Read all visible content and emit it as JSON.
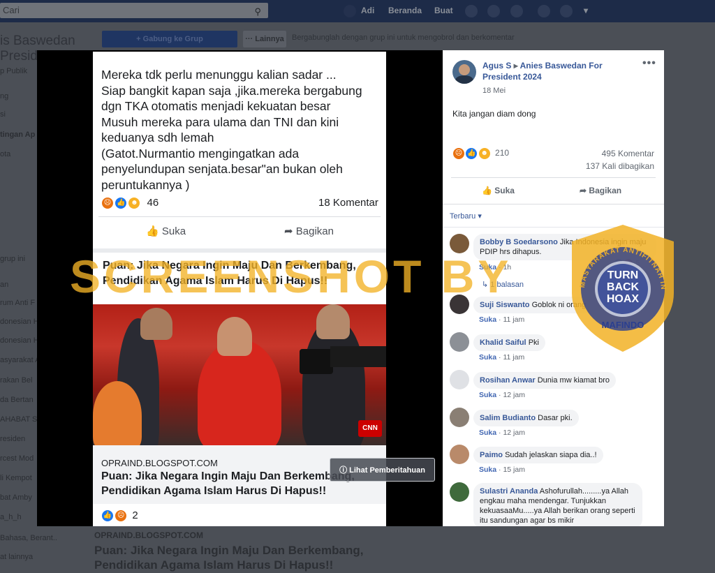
{
  "topbar": {
    "search_placeholder": "Cari",
    "user_name": "Adi",
    "home_label": "Beranda",
    "create_label": "Buat"
  },
  "sidebar": {
    "group_title_line1": "is Baswedan",
    "group_title_line2": "Preside",
    "group_privacy": "p Publik",
    "items": [
      "ng",
      "si",
      "tingan Ap",
      "ota",
      "",
      "grup ini",
      "an",
      "rum Anti F",
      "donesian H",
      "donesian H",
      "asyarakat A",
      "rakan Bel",
      "da Bertan",
      "AHABAT S",
      "residen",
      "rcest Mod",
      "li Kempot",
      "bat Amby",
      "a_h_h",
      "Bahasa, Berant..",
      "at lainnya"
    ]
  },
  "group_bar": {
    "join_label": "+ Gabung ke Grup",
    "more_label": "··· Lainnya",
    "note": "Bergabunglah dengan grup ini untuk mengobrol dan berkomentar"
  },
  "background_post": {
    "source": "OPRAIND.BLOGSPOT.COM",
    "title_line1": "Puan: Jika Negara Ingin Maju Dan Berkembang,",
    "title_line2": "Pendidikan Agama Islam Harus Di Hapus!!"
  },
  "screenshot_post": {
    "text_lines": [
      "Mereka tdk perlu menunggu kalian sadar ...",
      "Siap bangkit kapan saja ,jika.mereka bergabung",
      "dgn TKA otomatis menjadi kekuatan besar",
      "Musuh mereka para ulama dan TNI dan kini",
      "keduanya sdh lemah",
      "(Gatot.Nurmantio mengingatkan ada",
      "penyelundupan senjata.besar\"an bukan oleh",
      "peruntukannya )"
    ],
    "reaction_count": "46",
    "comment_count": "18 Komentar",
    "like_label": "Suka",
    "share_label": "Bagikan",
    "article_title_line1": "Puan: Jika Negara Ingin Maju Dan Berkembang,",
    "article_title_line2": "Pendidikan Agama Islam Harus Di Hapus!!",
    "link_domain": "OPRAIND.BLOGSPOT.COM",
    "link_title_line1": "Puan: Jika Negara Ingin Maju Dan Berkembang,",
    "link_title_line2": "Pendidikan Agama Islam Harus Di Hapus!!",
    "bottom_reaction_count": "2",
    "cnn_logo": "CNN"
  },
  "notification_button": "Lihat Pemberitahuan",
  "post": {
    "author": "Agus S",
    "arrow": "▸",
    "group": "Anies Baswedan For President 2024",
    "date": "18 Mei",
    "text": "Kita jangan diam dong",
    "reaction_count": "210",
    "comments": "495 Komentar",
    "shares": "137 Kali dibagikan",
    "like_label": "Suka",
    "share_label": "Bagikan",
    "sort_label": "Terbaru ▾"
  },
  "comments": [
    {
      "name": "Bobby B Soedarsono",
      "text": "Jika Indonesia ingin maju PDIP hrs dihapus.",
      "time": "1h",
      "like": "Suka",
      "reply_count": "5",
      "replies_label": "1 balasan"
    },
    {
      "name": "Suji Siswanto",
      "text": "Goblok ni orang",
      "time": "11 jam",
      "like": "Suka"
    },
    {
      "name": "Khalid Saiful",
      "text": "Pki",
      "time": "11 jam",
      "like": "Suka"
    },
    {
      "name": "Rosihan Anwar",
      "text": "Dunia mw kiamat bro",
      "time": "12 jam",
      "like": "Suka"
    },
    {
      "name": "Salim Budianto",
      "text": "Dasar pki.",
      "time": "12 jam",
      "like": "Suka"
    },
    {
      "name": "Paimo",
      "text": "Sudah jelaskan siapa dia..!",
      "time": "15 jam",
      "like": "Suka"
    },
    {
      "name": "Sulastri Ananda",
      "text": "Ashofurullah.........ya Allah engkau maha mendengar. Tunjukkan kekuasaaMu.....ya Allah berikan orang seperti itu sandungan agar bs mikir",
      "time": "",
      "like": ""
    }
  ],
  "watermark": "SCREENSHOT BY",
  "badge": {
    "ring_text": "MASYARAKAT ANTIFITNAH INDONESIA",
    "line1": "TURN",
    "line2": "BACK",
    "line3": "HOAX",
    "bottom": "MAFINDO"
  },
  "colors": {
    "facebook_blue": "#385898",
    "link_blue": "#4267b2",
    "watermark_orange": "#f2b226",
    "badge_blue": "#2b3f8f",
    "badge_yellow": "#f2b226"
  }
}
